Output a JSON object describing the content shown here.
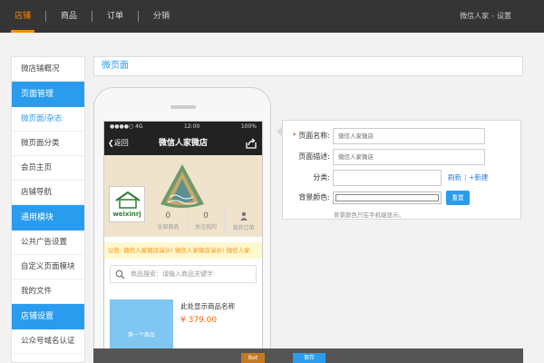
{
  "topnav": {
    "items": [
      {
        "label": "店铺",
        "active": true
      },
      {
        "label": "商品",
        "active": false
      },
      {
        "label": "订单",
        "active": false
      },
      {
        "label": "分销",
        "active": false
      }
    ],
    "user": "微信人家",
    "settings": "设置"
  },
  "sidebar": {
    "items": [
      {
        "label": "微店铺概况",
        "kind": "item"
      },
      {
        "label": "页面管理",
        "kind": "group"
      },
      {
        "label": "微页面/杂志",
        "kind": "item",
        "active": true
      },
      {
        "label": "微页面分类",
        "kind": "item"
      },
      {
        "label": "会员主页",
        "kind": "item"
      },
      {
        "label": "店铺导航",
        "kind": "item"
      },
      {
        "label": "通用模块",
        "kind": "group"
      },
      {
        "label": "公共广告设置",
        "kind": "item"
      },
      {
        "label": "自定义页面模块",
        "kind": "item"
      },
      {
        "label": "我的文件",
        "kind": "item"
      },
      {
        "label": "店铺设置",
        "kind": "group"
      },
      {
        "label": "公众号域名认证",
        "kind": "item"
      }
    ]
  },
  "page_title": "微页面",
  "phone": {
    "status_signal": "●●●●○ 4G",
    "status_time": "12:00",
    "status_battery": "100%",
    "back_label": "返回",
    "title": "微信人家微店",
    "logo_text": "weixinrj",
    "stats": [
      {
        "num": "0",
        "label": "全部商品"
      },
      {
        "num": "0",
        "label": "关注我的"
      },
      {
        "num": "",
        "label": "我的订单"
      }
    ],
    "notice": "公告: 微信人家微店演示!  微信人家微店演示!  微信人家",
    "search_placeholder": "商品搜索：请输入商品关键字",
    "product_image_label": "第一个商品",
    "product_name": "此处显示商品名称",
    "product_price": "¥ 379.00"
  },
  "form": {
    "name_label": "页面名称:",
    "name_value": "微信人家微店",
    "desc_label": "页面描述:",
    "desc_value": "微信人家微店",
    "category_label": "分类:",
    "category_value": "",
    "refresh_link": "刷新",
    "new_link": "+新建",
    "bg_label": "背景颜色:",
    "bg_color": "#ffffff",
    "reset_button": "重置",
    "hint": "背景颜色只在手机端显示。"
  },
  "bottom": {
    "logo_label": "Bot",
    "save_label": "保存"
  },
  "colors": {
    "accent": "#2a9cee",
    "topbar": "#353535",
    "active_tab": "#ff8a00",
    "price": "#ff6600"
  }
}
